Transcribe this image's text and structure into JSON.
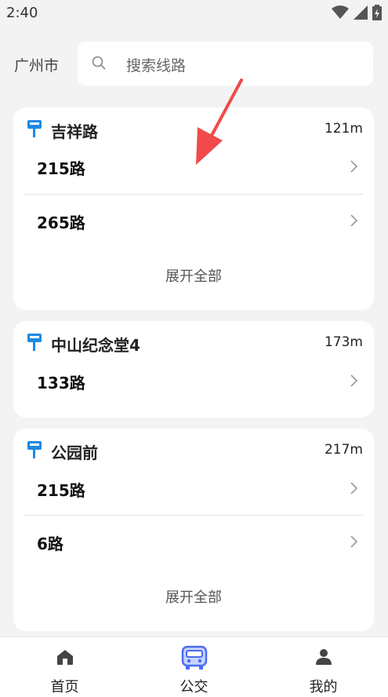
{
  "status": {
    "time": "2:40"
  },
  "search": {
    "city": "广州市",
    "placeholder": "搜索线路"
  },
  "stops": [
    {
      "name": "吉祥路",
      "distance": "121m",
      "routes": [
        "215路",
        "265路"
      ],
      "expand": "展开全部"
    },
    {
      "name": "中山纪念堂4",
      "distance": "173m",
      "routes": [
        "133路"
      ]
    },
    {
      "name": "公园前",
      "distance": "217m",
      "routes": [
        "215路",
        "6路"
      ],
      "expand": "展开全部"
    }
  ],
  "tabs": [
    {
      "label": "首页",
      "icon": "home-icon"
    },
    {
      "label": "公交",
      "icon": "bus-icon",
      "active": true
    },
    {
      "label": "我的",
      "icon": "person-icon"
    }
  ],
  "colors": {
    "accent": "#4a6cf7",
    "stop_icon": "#1e88e5",
    "annotation_arrow": "#f04a4a",
    "background": "#f3f3f3"
  }
}
